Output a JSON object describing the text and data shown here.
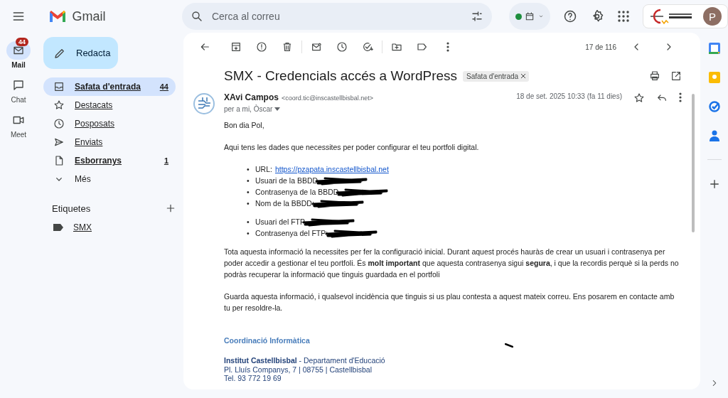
{
  "app": {
    "name": "Gmail"
  },
  "search": {
    "placeholder": "Cerca al correu"
  },
  "account": {
    "initial": "P"
  },
  "rail": [
    {
      "kind": "mail",
      "label": "Mail",
      "badge": "44",
      "selected": true
    },
    {
      "kind": "chat",
      "label": "Chat",
      "selected": false
    },
    {
      "kind": "meet",
      "label": "Meet",
      "selected": false
    }
  ],
  "compose": {
    "label": "Redacta"
  },
  "folders": [
    {
      "kind": "inbox",
      "label": "Safata d'entrada",
      "count": "44",
      "selected": true,
      "bold": true
    },
    {
      "kind": "star",
      "label": "Destacats",
      "selected": false,
      "bold": false
    },
    {
      "kind": "clock",
      "label": "Posposats",
      "selected": false,
      "bold": false
    },
    {
      "kind": "send",
      "label": "Enviats",
      "selected": false,
      "bold": false
    },
    {
      "kind": "draft",
      "label": "Esborranys",
      "count": "1",
      "selected": false,
      "bold": true
    },
    {
      "kind": "more",
      "label": "Més",
      "selected": false,
      "bold": false
    }
  ],
  "labels": {
    "title": "Etiquetes",
    "items": [
      {
        "label": "SMX"
      }
    ]
  },
  "pager": {
    "text": "17 de 116"
  },
  "message": {
    "subject": "SMX - Credencials accés a WordPress",
    "tag": "Safata d'entrada",
    "sender_name": "XAvi Campos",
    "sender_email": "<coord.tic@inscastellbisbal.net>",
    "recipients": "per a mi, Òscar",
    "date": "18 de set. 2025 10:33 (fa 11 dies)",
    "greeting": "Bon dia Pol,",
    "intro": "Aqui tens les dades que necessites per poder configurar el teu portfoli digital.",
    "list_groups": [
      [
        {
          "bullet": "•",
          "label": "URL:",
          "link": "https://pzapata.inscastellbisbal.net"
        },
        {
          "bullet": "•",
          "label": "Usuari de la BBDD",
          "redacted": true
        },
        {
          "bullet": "•",
          "label": "Contrasenya de la BBDD",
          "redacted": true
        },
        {
          "bullet": "•",
          "label": "Nom de la BBDD:",
          "redacted": true
        }
      ],
      [
        {
          "bullet": "•",
          "label": "Usuari del FTP",
          "redacted": true
        },
        {
          "bullet": "•",
          "label": "Contrasenya del FTP:",
          "redacted": true
        }
      ]
    ],
    "paragraphs": [
      "Tota aquesta informació la necessites per fer la configuració inicial. Durant aquest procés hauràs de crear un usuari i contrasenya per poder accedir a gestionar el teu portfoli. És **molt important** que aquesta contrasenya sigui **segura**, i que la recordis perquè si la perds no podràs recuperar la informació que tinguis guardada en el portfoli",
      "Guarda aquesta informació, i qualsevol incidència que tinguis si us plau contesta a aquest mateix correu. Ens posarem en contacte amb tu per resoldre-la."
    ],
    "signature": {
      "title": "Coordinació Informàtica",
      "lines": [
        "**Institut Castellbisbal** - Departament d'Educació",
        "Pl. Lluís Companys, 7 | 08755 | Castellbisbal",
        "Tel. 93 772 19 69"
      ]
    }
  }
}
